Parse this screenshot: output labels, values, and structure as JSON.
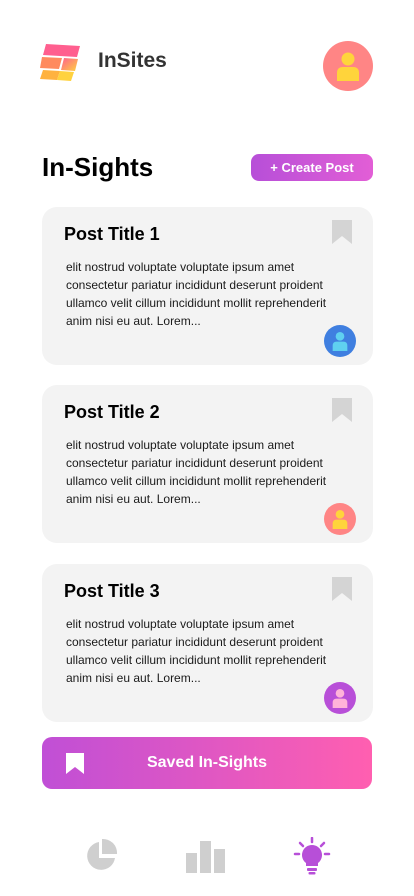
{
  "header": {
    "app_name": "InSites",
    "logo_icon": "insites-logo-icon",
    "profile_avatar_color": "#ff8585"
  },
  "main": {
    "title": "In-Sights",
    "create_post_label": "+ Create Post"
  },
  "posts": [
    {
      "title": "Post Title 1",
      "excerpt": "elit nostrud voluptate voluptate ipsum amet consectetur pariatur incididunt deserunt proident ullamco velit cillum incididunt mollit reprehenderit anim nisi eu aut. Lorem...",
      "author_avatar_color": "#3f7fe0",
      "author_figure_color": "#5fd0f0"
    },
    {
      "title": "Post Title 2",
      "excerpt": "elit nostrud voluptate voluptate ipsum amet consectetur pariatur incididunt deserunt proident ullamco velit cillum incididunt mollit reprehenderit anim nisi eu aut. Lorem...",
      "author_avatar_color": "#ff8585",
      "author_figure_color": "#ffd43b"
    },
    {
      "title": "Post Title 3",
      "excerpt": "elit nostrud voluptate voluptate ipsum amet consectetur pariatur incididunt deserunt proident ullamco velit cillum incididunt mollit reprehenderit anim nisi eu aut. Lorem...",
      "author_avatar_color": "#b84fd8",
      "author_figure_color": "#ffb3d9"
    }
  ],
  "saved": {
    "label": "Saved In-Sights"
  },
  "bottom_nav": [
    {
      "icon": "pie-chart-icon",
      "active": false
    },
    {
      "icon": "bar-chart-icon",
      "active": false
    },
    {
      "icon": "lightbulb-icon",
      "active": true
    }
  ],
  "colors": {
    "accent_purple": "#b74fd8",
    "accent_pink": "#ff5fb0",
    "card_bg": "#f3f3f3",
    "inactive_icon": "#cfcfcf"
  }
}
